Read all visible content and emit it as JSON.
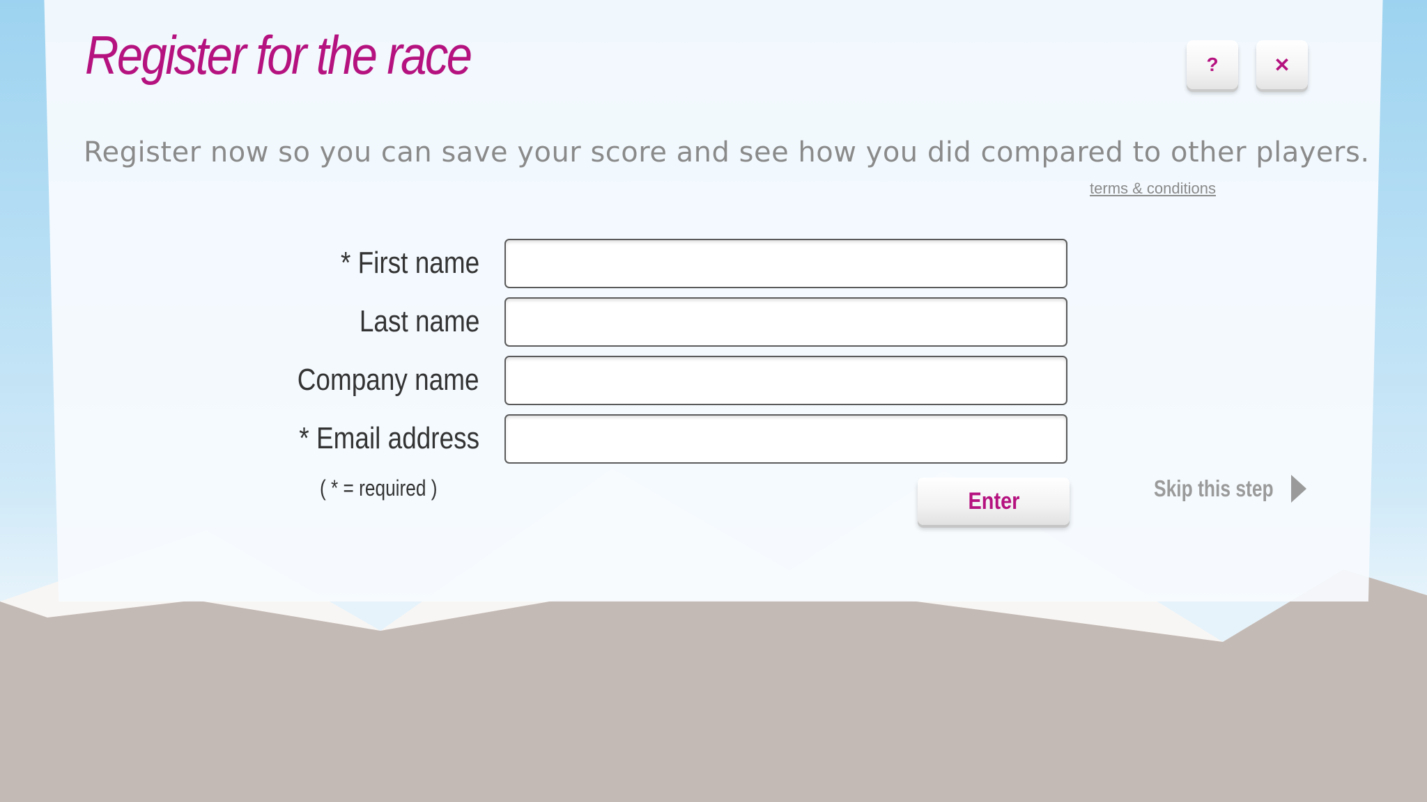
{
  "dialog": {
    "title": "Register for the race",
    "help_label": "?",
    "close_label": "✕",
    "intro": "Register now so you can save your score and see how you did compared to other players.",
    "terms_link": "terms & conditions"
  },
  "form": {
    "fields": [
      {
        "label": "* First name",
        "value": "",
        "required": true
      },
      {
        "label": "Last name",
        "value": "",
        "required": false
      },
      {
        "label": "Company name",
        "value": "",
        "required": false
      },
      {
        "label": "* Email address",
        "value": "",
        "required": true
      }
    ],
    "required_note": "( * = required )",
    "submit_label": "Enter",
    "skip_label": "Skip this step"
  },
  "colors": {
    "accent": "#b5127f",
    "sky": "#9dd3f0",
    "ground": "#c4bab5",
    "snow": "#f8f6f4",
    "muted_text": "#8a8a8a"
  },
  "icons": {
    "help": "question-mark-icon",
    "close": "close-icon",
    "skip": "arrow-right-icon"
  }
}
